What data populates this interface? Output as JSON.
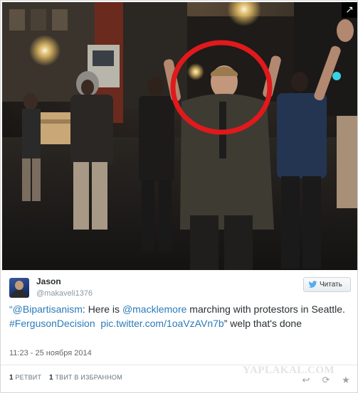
{
  "tweet": {
    "author_name": "Jason",
    "author_handle": "@makaveli1376",
    "follow_label": "Читать",
    "text_parts": {
      "open_quote": "“",
      "mention1": "@Bipartisanism",
      "mid1": ": Here is ",
      "mention2": "@macklemore",
      "mid2": " marching with protestors in Seattle. ",
      "hashtag": "#FergusonDecision",
      "space": "  ",
      "pic_link": "pic.twitter.com/1oaVzAVn7b",
      "tail": "” welp that's done"
    },
    "timestamp": "11:23 - 25 ноября 2014",
    "retweets_count": "1",
    "retweets_label": "РЕТВИТ",
    "favorites_count": "1",
    "favorites_label": "ТВИТ В ИЗБРАННОМ"
  },
  "watermark": "YAPLAKAL.COM",
  "icons": {
    "expand": "↗",
    "reply": "↩",
    "retweet": "⟳",
    "favorite": "★"
  },
  "colors": {
    "link": "#2b7bb9",
    "highlight_circle": "#e0191c"
  }
}
